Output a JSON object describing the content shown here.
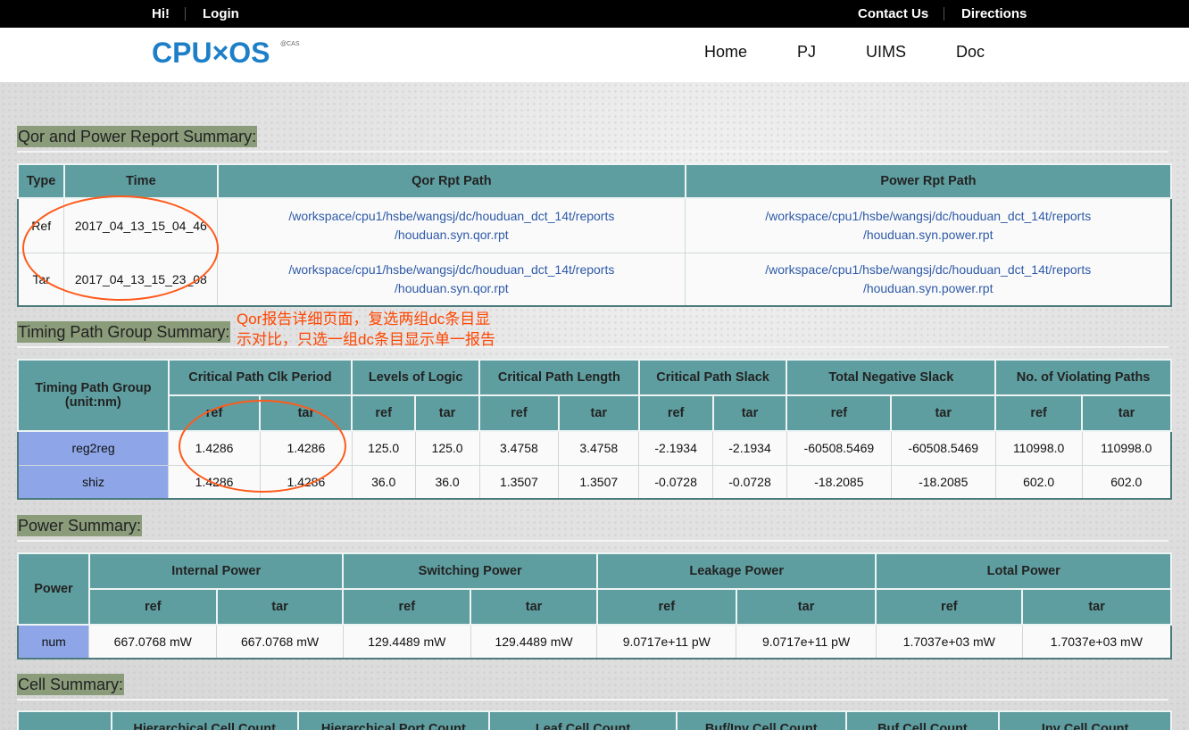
{
  "topbar": {
    "hi": "Hi!",
    "login": "Login",
    "contact": "Contact Us",
    "directions": "Directions"
  },
  "header": {
    "logo_text": "CPU×OS",
    "logo_sup": "@CAS"
  },
  "nav": [
    {
      "label": "Home"
    },
    {
      "label": "PJ"
    },
    {
      "label": "UIMS"
    },
    {
      "label": "Doc"
    }
  ],
  "qor": {
    "title": "Qor and Power Report Summary:",
    "headers": [
      "Type",
      "Time",
      "Qor Rpt Path",
      "Power Rpt Path"
    ],
    "rows": [
      {
        "type": "Ref",
        "time": "2017_04_13_15_04_46",
        "qor_l1": "/workspace/cpu1/hsbe/wangsj/dc/houduan_dct_14t/reports",
        "qor_l2": "/houduan.syn.qor.rpt",
        "pow_l1": "/workspace/cpu1/hsbe/wangsj/dc/houduan_dct_14t/reports",
        "pow_l2": "/houduan.syn.power.rpt"
      },
      {
        "type": "Tar",
        "time": "2017_04_13_15_23_08",
        "qor_l1": "/workspace/cpu1/hsbe/wangsj/dc/houduan_dct_14t/reports",
        "qor_l2": "/houduan.syn.qor.rpt",
        "pow_l1": "/workspace/cpu1/hsbe/wangsj/dc/houduan_dct_14t/reports",
        "pow_l2": "/houduan.syn.power.rpt"
      }
    ]
  },
  "annotation": {
    "line1": "Qor报告详细页面，复选两组dc条目显",
    "line2": "示对比，只选一组dc条目显示单一报告"
  },
  "timing": {
    "title": "Timing Path Group Summary:",
    "group_header_l1": "Timing Path Group",
    "group_header_l2": "(unit:nm)",
    "headers": [
      "Critical Path Clk Period",
      "Levels of Logic",
      "Critical Path Length",
      "Critical Path Slack",
      "Total Negative Slack",
      "No. of Violating Paths"
    ],
    "ref": "ref",
    "tar": "tar",
    "rows": [
      {
        "name": "reg2reg",
        "v": [
          "1.4286",
          "1.4286",
          "125.0",
          "125.0",
          "3.4758",
          "3.4758",
          "-2.1934",
          "-2.1934",
          "-60508.5469",
          "-60508.5469",
          "110998.0",
          "110998.0"
        ]
      },
      {
        "name": "shiz",
        "v": [
          "1.4286",
          "1.4286",
          "36.0",
          "36.0",
          "1.3507",
          "1.3507",
          "-0.0728",
          "-0.0728",
          "-18.2085",
          "-18.2085",
          "602.0",
          "602.0"
        ]
      }
    ]
  },
  "power": {
    "title": "Power Summary:",
    "first_header": "Power",
    "headers": [
      "Internal Power",
      "Switching Power",
      "Leakage Power",
      "Lotal Power"
    ],
    "ref": "ref",
    "tar": "tar",
    "row": {
      "name": "num",
      "v": [
        "667.0768 mW",
        "667.0768 mW",
        "129.4489 mW",
        "129.4489 mW",
        "9.0717e+11 pW",
        "9.0717e+11 pW",
        "1.7037e+03 mW",
        "1.7037e+03 mW"
      ]
    }
  },
  "cell": {
    "title": "Cell Summary:",
    "headers": [
      "Hierarchical Cell Count",
      "Hierarchical Port Count",
      "Leaf Cell Count",
      "Buf/Inv Cell Count",
      "Buf Cell Count",
      "Inv Cell Count"
    ]
  },
  "colors": {
    "header_teal": "#5f9ea0",
    "label_blue": "#8ea6e8",
    "section_green": "#8a9c7a",
    "annotation": "#ff4500"
  }
}
